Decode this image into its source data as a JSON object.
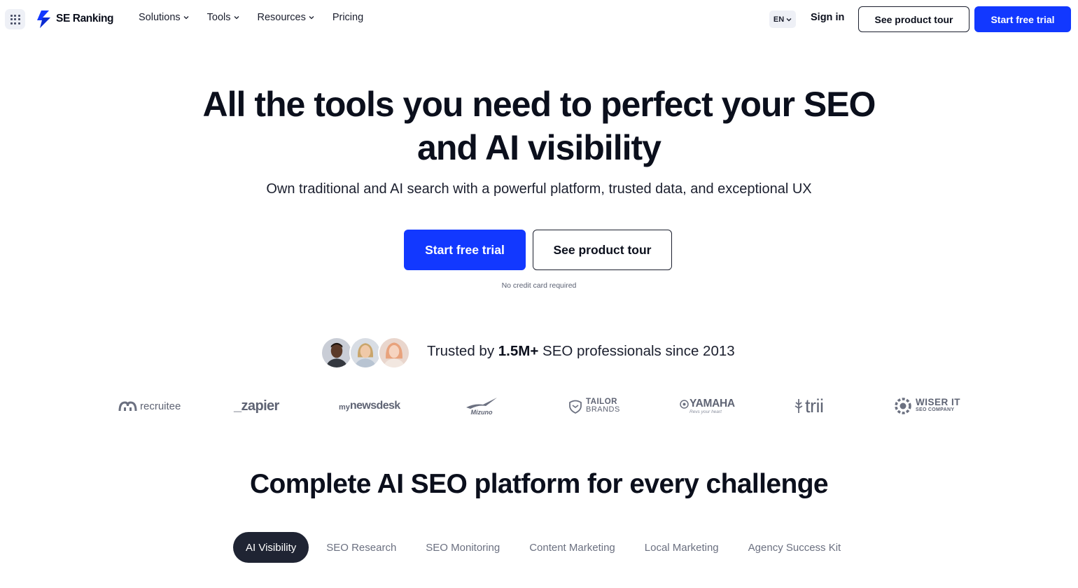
{
  "header": {
    "logo_text": "SE Ranking",
    "nav": [
      {
        "label": "Solutions"
      },
      {
        "label": "Tools"
      },
      {
        "label": "Resources"
      },
      {
        "label": "Pricing"
      }
    ],
    "language": "EN",
    "sign_in": "Sign in",
    "tour_button": "See product tour",
    "trial_button": "Start free trial"
  },
  "hero": {
    "title_line1": "All the tools you need to perfect your SEO",
    "title_line2": "and AI visibility",
    "subtitle": "Own traditional and AI search with a powerful platform, trusted data, and exceptional UX",
    "primary_cta": "Start free trial",
    "secondary_cta": "See product tour",
    "note": "No credit card required"
  },
  "trusted": {
    "prefix": "Trusted by ",
    "count": "1.5M+",
    "suffix": " SEO professionals since 2013"
  },
  "logos": {
    "recruitee": "recruitee",
    "zapier": "_zapier",
    "mynewsdesk_prefix": "my",
    "mynewsdesk": "newsdesk",
    "mizuno": "Mizuno",
    "tailor_1": "TAILOR",
    "tailor_2": "BRANDS",
    "yamaha": "YAMAHA",
    "yamaha_tag": "Revs your heart",
    "trii": "trii",
    "wiser_1": "WISER IT",
    "wiser_2": "SEO COMPANY"
  },
  "section": {
    "title": "Complete AI SEO platform for every challenge",
    "tabs": [
      {
        "label": "AI Visibility",
        "active": true
      },
      {
        "label": "SEO Research"
      },
      {
        "label": "SEO Monitoring"
      },
      {
        "label": "Content Marketing"
      },
      {
        "label": "Local Marketing"
      },
      {
        "label": "Agency Success Kit"
      }
    ]
  },
  "colors": {
    "brand_blue": "#1238ff",
    "dark": "#0b0f1c",
    "tab_active_bg": "#1f2433",
    "logo_gray": "#6b7080"
  }
}
